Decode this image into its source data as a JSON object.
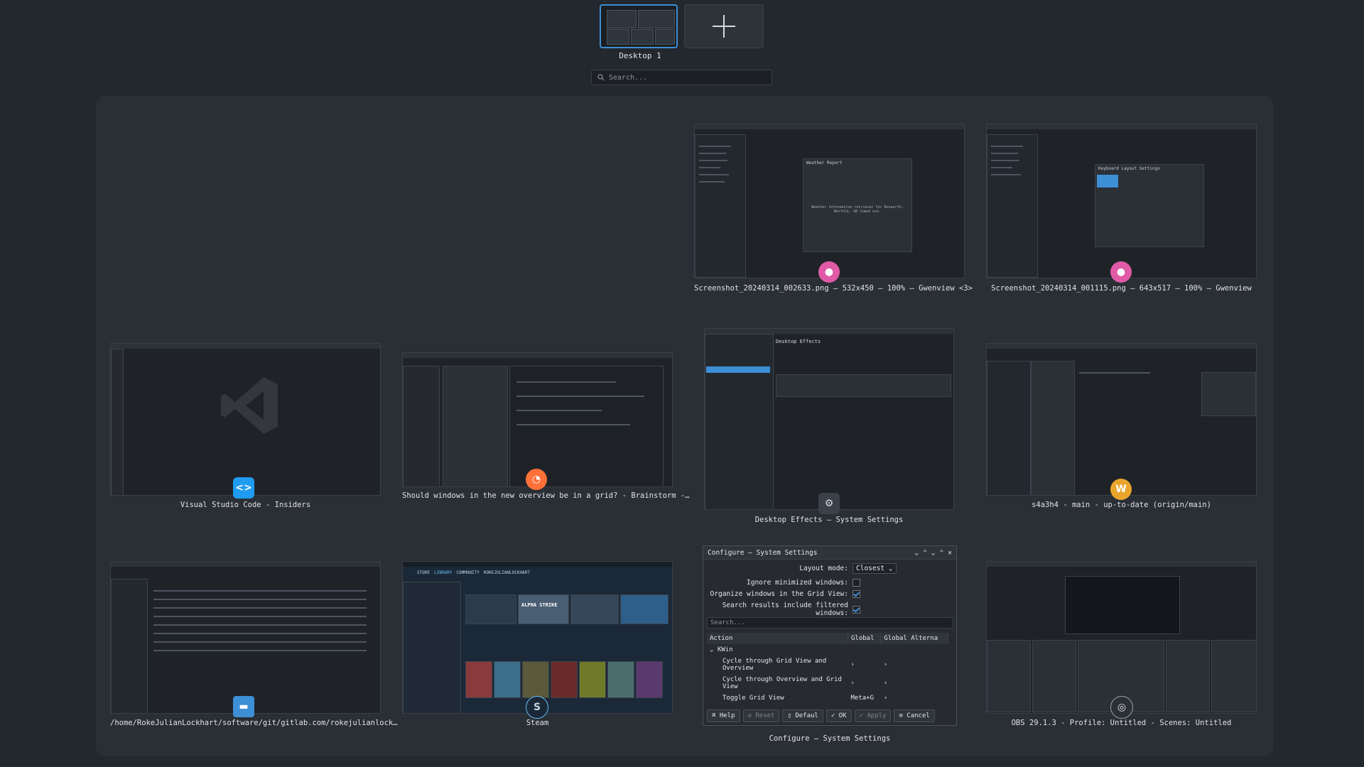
{
  "desktops": {
    "items": [
      {
        "label": "Desktop 1"
      }
    ],
    "add_icon": "plus-icon"
  },
  "search": {
    "placeholder": "Search..."
  },
  "windows": [
    {
      "id": "gwenview1",
      "caption": "Screenshot_20240314_002633.png — 532x450 — 100% — Gwenview <3>",
      "icon": "gwenview-icon",
      "inner": "Weather Report",
      "inner_text": "Weather information retrieval for Bosworth, Norfolk, GB timed out."
    },
    {
      "id": "gwenview2",
      "caption": "Screenshot_20240314_001115.png — 643x517 — 100% — Gwenview",
      "icon": "gwenview-icon",
      "inner": "Keyboard Layout Settings"
    },
    {
      "id": "vscode",
      "caption": "Visual Studio Code - Insiders",
      "icon": "vscode-icon"
    },
    {
      "id": "firefox",
      "caption": "Should windows in the new overview be in a grid? - Brainstorm -…",
      "icon": "firefox-icon"
    },
    {
      "id": "desktop-effects",
      "caption": "Desktop Effects — System Settings",
      "icon": "system-settings-icon",
      "inner": "Desktop Effects"
    },
    {
      "id": "gitclient",
      "caption": "s4a3h4 - main - up-to-date (origin/main)",
      "icon": "git-client-icon"
    },
    {
      "id": "filemanager",
      "caption": "/home/RokeJulianLockhart/software/git/gitlab.com/rokejulianlock…",
      "icon": "folder-icon"
    },
    {
      "id": "steam",
      "caption": "Steam",
      "icon": "steam-icon",
      "inner_tabs": [
        "STORE",
        "LIBRARY",
        "COMMUNITY",
        "ROKEJULIANLOCKHART"
      ],
      "game": "ALPHA STRIKE"
    },
    {
      "id": "configure",
      "caption": "Configure — System Settings",
      "icon": "system-settings-icon"
    },
    {
      "id": "obs",
      "caption": "OBS 29.1.3 - Profile: Untitled - Scenes: Untitled",
      "icon": "obs-icon"
    }
  ],
  "configure_dialog": {
    "title": "Configure — System Settings",
    "layout_mode_label": "Layout mode:",
    "layout_mode_value": "Closest",
    "ignore_minimized_label": "Ignore minimized windows:",
    "ignore_minimized": false,
    "organize_grid_label": "Organize windows in the Grid View:",
    "organize_grid": true,
    "search_filtered_label": "Search results include filtered windows:",
    "search_filtered": true,
    "search_placeholder": "Search...",
    "columns": [
      "Action",
      "Global",
      "Global Alterna"
    ],
    "group": "KWin",
    "actions": [
      {
        "name": "Cycle through Grid View and Overview",
        "shortcut": ""
      },
      {
        "name": "Cycle through Overview and Grid View",
        "shortcut": ""
      },
      {
        "name": "Toggle Grid View",
        "shortcut": "Meta+G"
      }
    ],
    "buttons": {
      "help": "Help",
      "reset": "Reset",
      "defaults": "Defaul",
      "ok": "OK",
      "apply": "Apply",
      "cancel": "Cancel"
    }
  }
}
